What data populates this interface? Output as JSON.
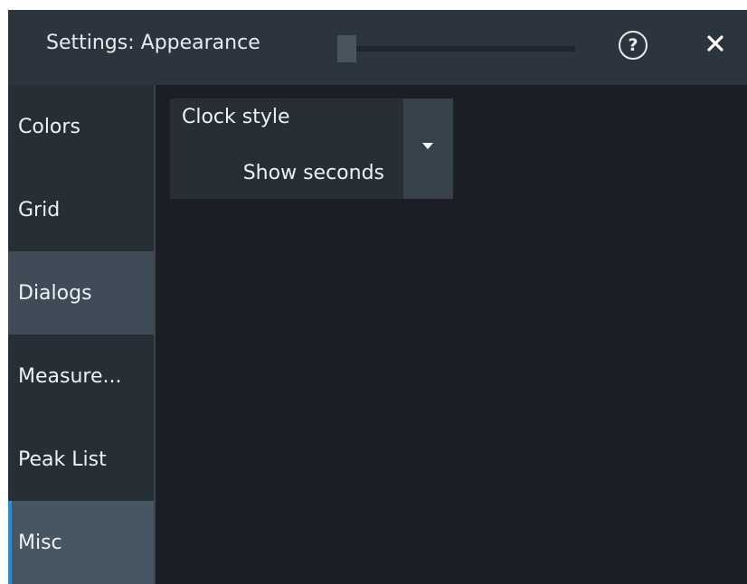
{
  "window": {
    "title": "Settings: Appearance",
    "transparency_level": 0.0
  },
  "icons": {
    "help": "help-circle-icon",
    "close": "close-icon",
    "dropdown": "caret-down-icon"
  },
  "sidebar": {
    "items": [
      {
        "label": "Colors"
      },
      {
        "label": "Grid"
      },
      {
        "label": "Dialogs"
      },
      {
        "label": "Measure..."
      },
      {
        "label": "Peak List"
      },
      {
        "label": "Misc"
      }
    ],
    "active": "Misc"
  },
  "main": {
    "clock_style": {
      "label": "Clock style",
      "value": "Show seconds"
    }
  },
  "colors": {
    "accent": "#1e8fe8",
    "background": "#1b1f25",
    "panel": "#262e36"
  }
}
